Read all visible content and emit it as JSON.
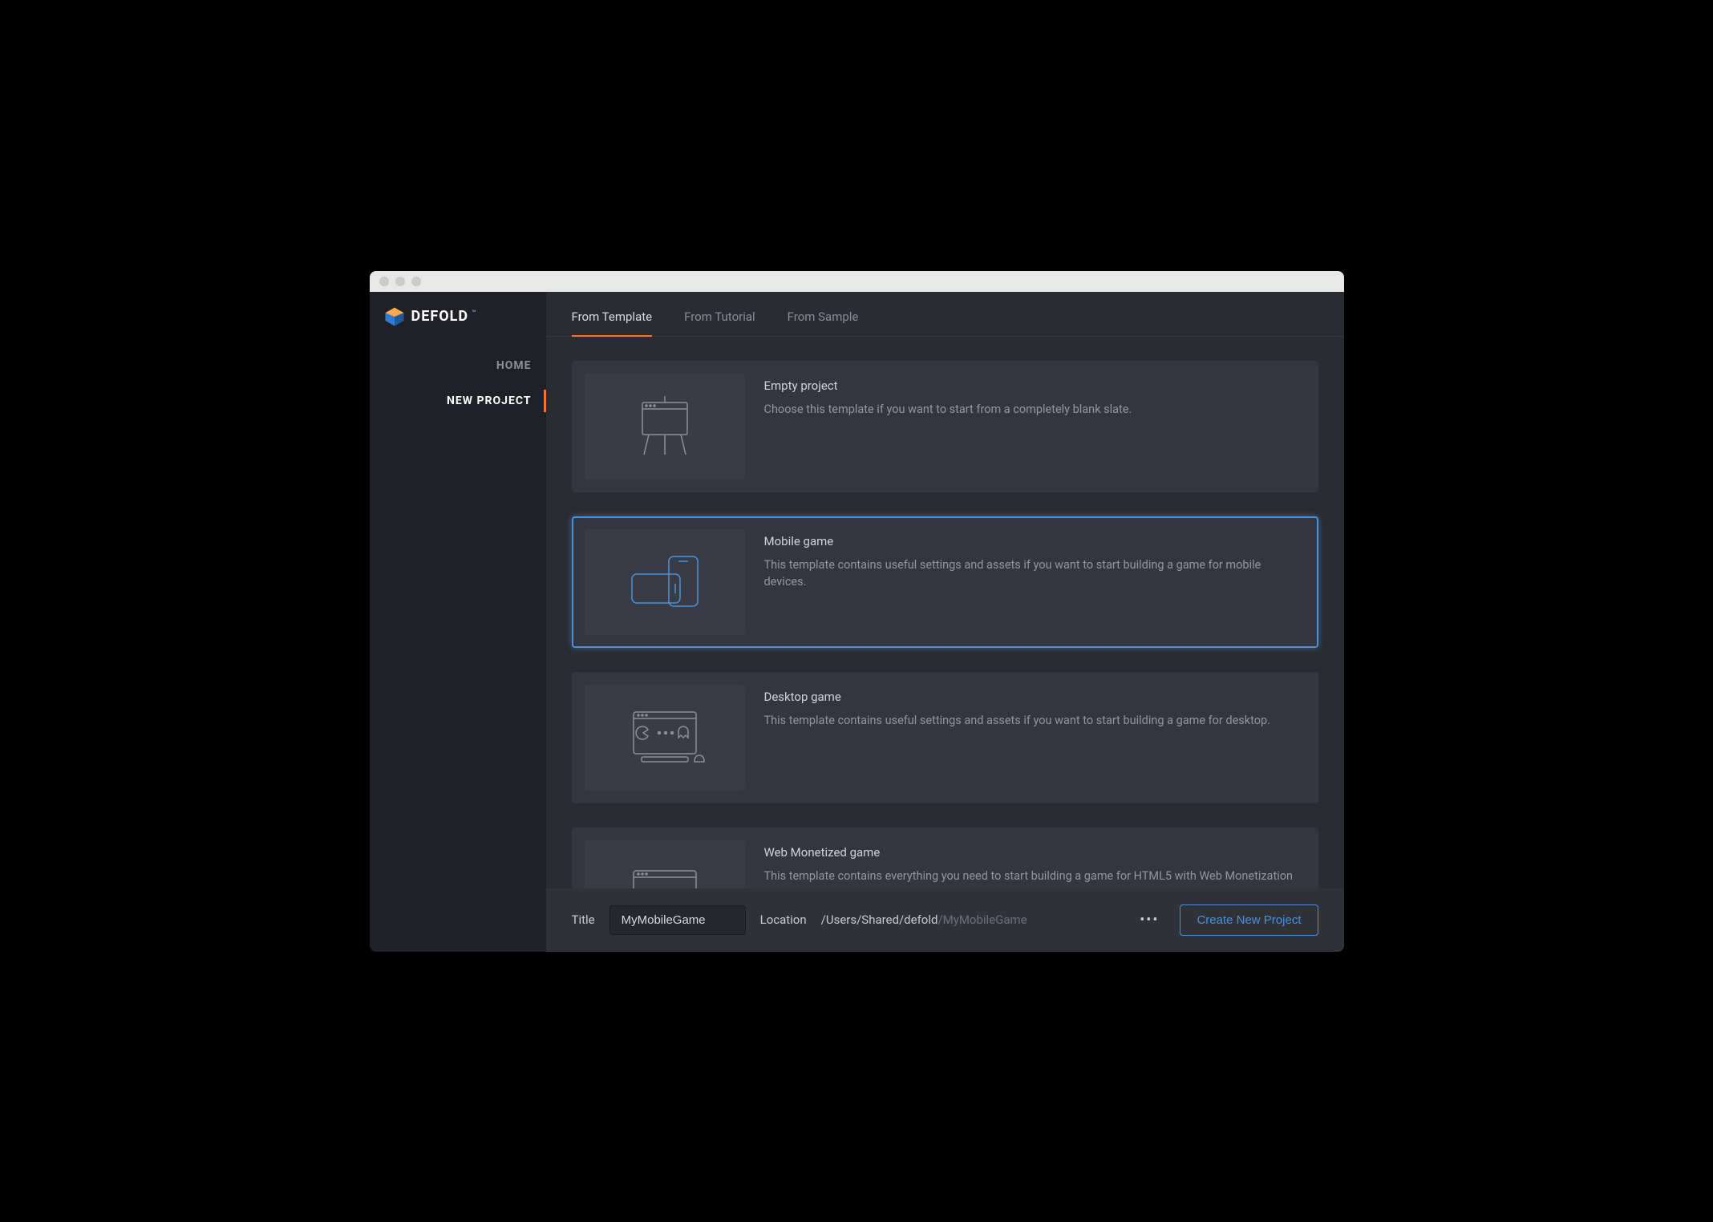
{
  "brand": {
    "name": "DEFOLD"
  },
  "sidebar": {
    "items": [
      {
        "label": "HOME",
        "active": false
      },
      {
        "label": "NEW PROJECT",
        "active": true
      }
    ]
  },
  "tabs": [
    {
      "label": "From Template",
      "active": true
    },
    {
      "label": "From Tutorial",
      "active": false
    },
    {
      "label": "From Sample",
      "active": false
    }
  ],
  "templates": [
    {
      "title": "Empty project",
      "description": "Choose this template if you want to start from a completely blank slate.",
      "selected": false,
      "icon": "easel"
    },
    {
      "title": "Mobile game",
      "description": "This template contains useful settings and assets if you want to start building a game for mobile devices.",
      "selected": true,
      "icon": "mobile"
    },
    {
      "title": "Desktop game",
      "description": "This template contains useful settings and assets if you want to start building a game for desktop.",
      "selected": false,
      "icon": "desktop"
    },
    {
      "title": "Web Monetized game",
      "description": "This template contains everything you need to start building a game for HTML5 with Web Monetization",
      "selected": false,
      "icon": "web"
    }
  ],
  "footer": {
    "title_label": "Title",
    "title_value": "MyMobileGame",
    "location_label": "Location",
    "location_base": "/Users/Shared/defold",
    "location_suffix": "/MyMobileGame",
    "more": "•••",
    "create_label": "Create New Project"
  }
}
